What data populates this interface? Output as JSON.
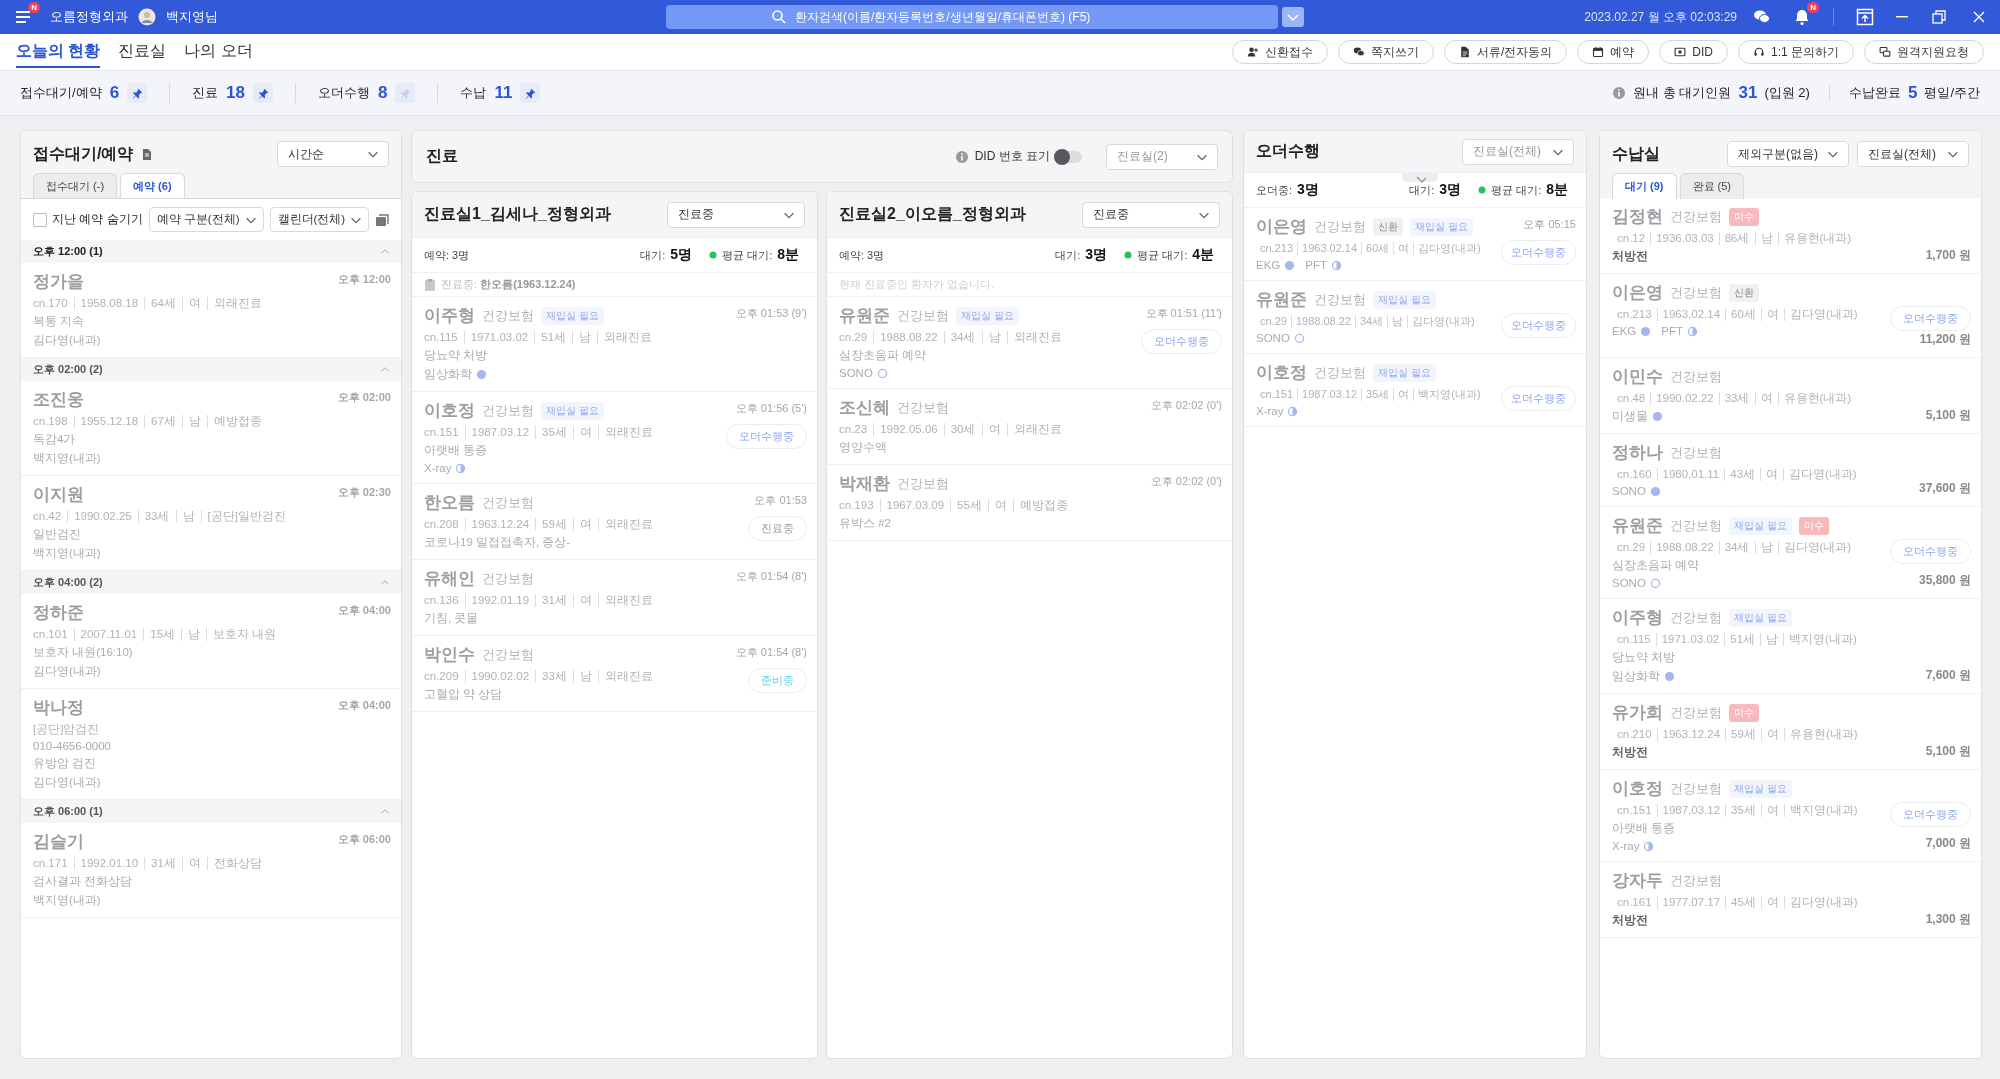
{
  "topbar": {
    "menu_badge": "N",
    "clinic": "오름정형외과",
    "user": "백지영님",
    "search": {
      "placeholder": "환자검색(이름/환자등록번호/생년월일/휴대폰번호) (F5)"
    },
    "datetime": "2023.02.27 월 오후 02:03:29",
    "alert_badge": "N"
  },
  "nav_tabs": [
    {
      "label": "오늘의 현황",
      "selected": true
    },
    {
      "label": "진료실",
      "selected": false
    },
    {
      "label": "나의 오더",
      "selected": false
    }
  ],
  "header_buttons": [
    {
      "label": "신환접수",
      "kind": "person"
    },
    {
      "label": "쪽지쓰기",
      "kind": "chat"
    },
    {
      "label": "서류/전자동의",
      "kind": "document"
    },
    {
      "label": "예약",
      "kind": "calendar"
    },
    {
      "label": "DID",
      "kind": "display"
    },
    {
      "label": "1:1 문의하기",
      "kind": "headset"
    },
    {
      "label": "원격지원요청",
      "kind": "remote"
    }
  ],
  "summary": [
    {
      "label": "접수대기/예약",
      "count": "6",
      "pinned": true
    },
    {
      "label": "진료",
      "count": "18",
      "pinned": true
    },
    {
      "label": "오더수행",
      "count": "8",
      "pinned": false
    },
    {
      "label": "수납",
      "count": "11",
      "pinned": true
    }
  ],
  "waiting_summary": {
    "label": "원내 총 대기인원",
    "count": "31",
    "note": "(입원 2)",
    "paid_label": "수납완료",
    "paid_count": "5",
    "period": "평일/주간"
  },
  "reception": {
    "title": "접수대기/예약",
    "sort": "시간순",
    "tabs": [
      {
        "label": "접수대기 (-)",
        "selected": false
      },
      {
        "label": "예약 (6)",
        "selected": true
      }
    ],
    "hide_past": {
      "label": "지난 예약 숨기기",
      "checked": false
    },
    "filters": [
      "예약 구분(전체)",
      "캘린더(전체)"
    ],
    "groups": [
      {
        "time": "오후 12:00 (1)",
        "expanded": true,
        "patients": [
          {
            "name": "정가을",
            "time": "오후 12:00",
            "meta": [
              "cn.170",
              "1958.08.18",
              "64세",
              "여",
              "외래진료"
            ],
            "notes": [
              "복통 지속",
              "김다영(내과)"
            ]
          }
        ]
      },
      {
        "time": "오후 02:00 (2)",
        "expanded": true,
        "patients": [
          {
            "name": "조진웅",
            "time": "오후 02:00",
            "meta": [
              "cn.198",
              "1955.12.18",
              "67세",
              "남",
              "예방접종"
            ],
            "notes": [
              "독감4가",
              "백지영(내과)"
            ]
          },
          {
            "name": "이지원",
            "time": "오후 02:30",
            "meta": [
              "cn.42",
              "1990.02.25",
              "33세",
              "남",
              "[공단]일반검진"
            ],
            "notes": [
              "일반검진",
              "백지영(내과)"
            ]
          }
        ]
      },
      {
        "time": "오후 04:00 (2)",
        "expanded": true,
        "patients": [
          {
            "name": "정하준",
            "time": "오후 04:00",
            "meta": [
              "cn.101",
              "2007.11.01",
              "15세",
              "남",
              "보호자 내원"
            ],
            "notes": [
              "보호자 내원(16:10)",
              "김다영(내과)"
            ]
          },
          {
            "name": "박나정",
            "time": "오후 04:00",
            "meta": [
              "[공단]암검진"
            ],
            "notes": [
              "010-4656-0000",
              "유방암 검진",
              "김다영(내과)"
            ]
          }
        ]
      },
      {
        "time": "오후 06:00 (1)",
        "expanded": true,
        "patients": [
          {
            "name": "김슬기",
            "time": "오후 06:00",
            "meta": [
              "cn.171",
              "1992.01.10",
              "31세",
              "여",
              "전화상담"
            ],
            "notes": [
              "검사결과 전화상담",
              "백지영(내과)"
            ]
          }
        ]
      }
    ]
  },
  "treatment": {
    "title": "진료",
    "did": {
      "label": "DID 번호 표기",
      "on": false
    },
    "room_filter": "진료실(2)",
    "rooms": [
      {
        "title": "진료실1_김세나_정형외과",
        "status": "진료중",
        "reserved": "예약: 3명",
        "waiting_label": "대기:",
        "waiting": "5명",
        "avg_label": "평균 대기:",
        "avg": "8분",
        "current": {
          "kind": "patient",
          "text": "진료중: **한오름(1963.12.24)**"
        },
        "patients": [
          {
            "name": "이주형",
            "insurance": "건강보험",
            "tags": [
              {
                "text": "재입실 필요",
                "kind": "reentry"
              }
            ],
            "time": "오후 01:53 (9')",
            "meta": [
              "cn.115",
              "1971.03.02",
              "51세",
              "남",
              "외래진료"
            ],
            "notes": [
              "당뇨약 처방"
            ],
            "orders": [
              {
                "name": "임상화학",
                "kind": "done"
              }
            ]
          },
          {
            "name": "이호정",
            "insurance": "건강보험",
            "tags": [
              {
                "text": "재입실 필요",
                "kind": "reentry"
              }
            ],
            "time": "오후 01:56 (5')",
            "meta": [
              "cn.151",
              "1987.03.12",
              "35세",
              "여",
              "외래진료"
            ],
            "notes": [
              "아랫배 통증"
            ],
            "orders": [
              {
                "name": "X-ray",
                "kind": "partial"
              }
            ],
            "badge": {
              "text": "오더수행중",
              "kind": "order"
            }
          },
          {
            "name": "한오름",
            "insurance": "건강보험",
            "time": "오후 01:53",
            "meta": [
              "cn.208",
              "1963.12.24",
              "59세",
              "여",
              "외래진료"
            ],
            "notes": [
              "코로나19 밀접접촉자, 증상-"
            ],
            "badge": {
              "text": "진료중",
              "kind": "treating"
            }
          },
          {
            "name": "유해인",
            "insurance": "건강보험",
            "time": "오후 01:54 (8')",
            "meta": [
              "cn.136",
              "1992.01.19",
              "31세",
              "여",
              "외래진료"
            ],
            "notes": [
              "기침, 콧물"
            ]
          },
          {
            "name": "박인수",
            "insurance": "건강보험",
            "time": "오후 01:54 (8')",
            "meta": [
              "cn.209",
              "1990.02.02",
              "33세",
              "남",
              "외래진료"
            ],
            "notes": [
              "고혈압 약 상담"
            ],
            "badge": {
              "text": "준비중",
              "kind": "ready"
            }
          }
        ]
      },
      {
        "title": "진료실2_이오름_정형외과",
        "status": "진료중",
        "reserved": "예약: 3명",
        "waiting_label": "대기:",
        "waiting": "3명",
        "avg_label": "평균 대기:",
        "avg": "4분",
        "current": {
          "kind": "none",
          "text": "현재 진료중인 환자가 없습니다."
        },
        "patients": [
          {
            "name": "유원준",
            "insurance": "건강보험",
            "tags": [
              {
                "text": "재입실 필요",
                "kind": "reentry"
              }
            ],
            "time": "오후 01:51 (11')",
            "meta": [
              "cn.29",
              "1988.08.22",
              "34세",
              "남",
              "외래진료"
            ],
            "notes": [
              "심장초음파 예약"
            ],
            "orders": [
              {
                "name": "SONO",
                "kind": "pending"
              }
            ],
            "badge": {
              "text": "오더수행중",
              "kind": "order"
            }
          },
          {
            "name": "조신혜",
            "insurance": "건강보험",
            "time": "오후 02:02 (0')",
            "meta": [
              "cn.23",
              "1992.05.06",
              "30세",
              "여",
              "외래진료"
            ],
            "notes": [
              "영양수액"
            ]
          },
          {
            "name": "박재환",
            "insurance": "건강보험",
            "time": "오후 02:02 (0')",
            "meta": [
              "cn.193",
              "1967.03.09",
              "55세",
              "여",
              "예방접종"
            ],
            "notes": [
              "유박스 #2"
            ]
          }
        ]
      }
    ]
  },
  "orders": {
    "title": "오더수행",
    "room_filter": "진료실(전체)",
    "in_progress_label": "오더중:",
    "in_progress": "3명",
    "waiting_label": "대기:",
    "waiting": "3명",
    "avg_label": "평균 대기:",
    "avg": "8분",
    "patients": [
      {
        "name": "이은영",
        "insurance": "건강보험",
        "tags": [
          {
            "text": "신환",
            "kind": "new"
          },
          {
            "text": "재입실 필요",
            "kind": "reentry"
          }
        ],
        "time": "오후 05:15",
        "meta": [
          "cn.213",
          "1963.02.14",
          "60세",
          "여",
          "김다영(내과)"
        ],
        "orders": [
          {
            "name": "EKG",
            "kind": "done"
          },
          {
            "name": "PFT",
            "kind": "partial"
          }
        ],
        "badge": {
          "text": "오더수행중",
          "kind": "order"
        }
      },
      {
        "name": "유원준",
        "insurance": "건강보험",
        "tags": [
          {
            "text": "재입실 필요",
            "kind": "reentry"
          }
        ],
        "meta": [
          "cn.29",
          "1988.08.22",
          "34세",
          "남",
          "김다영(내과)"
        ],
        "orders": [
          {
            "name": "SONO",
            "kind": "pending"
          }
        ],
        "badge": {
          "text": "오더수행중",
          "kind": "order"
        }
      },
      {
        "name": "이호정",
        "insurance": "건강보험",
        "tags": [
          {
            "text": "재입실 필요",
            "kind": "reentry"
          }
        ],
        "meta": [
          "cn.151",
          "1987.03.12",
          "35세",
          "여",
          "백지영(내과)"
        ],
        "orders": [
          {
            "name": "X-ray",
            "kind": "partial"
          }
        ],
        "badge": {
          "text": "오더수행중",
          "kind": "order"
        }
      }
    ]
  },
  "payment": {
    "title": "수납실",
    "filters": [
      "제외구분(없음)",
      "진료실(전체)"
    ],
    "tabs": [
      {
        "label": "대기 (9)",
        "selected": true
      },
      {
        "label": "완료 (5)",
        "selected": false
      }
    ],
    "patients": [
      {
        "name": "김정현",
        "insurance": "건강보험",
        "tags": [
          {
            "text": "미수",
            "kind": "unpaid"
          }
        ],
        "meta": [
          "cn.12",
          "1936.03.03",
          "86세",
          "남",
          "유용현(내과)"
        ],
        "stage": "처방전",
        "amount": "1,700 원"
      },
      {
        "name": "이은영",
        "insurance": "건강보험",
        "tags": [
          {
            "text": "신환",
            "kind": "new"
          }
        ],
        "meta": [
          "cn.213",
          "1963.02.14",
          "60세",
          "여",
          "김다영(내과)"
        ],
        "orders": [
          {
            "name": "EKG",
            "kind": "done"
          },
          {
            "name": "PFT",
            "kind": "partial"
          }
        ],
        "badge": {
          "text": "오더수행중",
          "kind": "order"
        },
        "amount": "11,200 원"
      },
      {
        "name": "이민수",
        "insurance": "건강보험",
        "meta": [
          "cn.48",
          "1990.02.22",
          "33세",
          "여",
          "유용현(내과)"
        ],
        "orders": [
          {
            "name": "미생물",
            "kind": "done"
          }
        ],
        "amount": "5,100 원"
      },
      {
        "name": "정하나",
        "insurance": "건강보험",
        "meta": [
          "cn.160",
          "1980.01.11",
          "43세",
          "여",
          "김다영(내과)"
        ],
        "orders": [
          {
            "name": "SONO",
            "kind": "done"
          }
        ],
        "amount": "37,600 원"
      },
      {
        "name": "유원준",
        "insurance": "건강보험",
        "tags": [
          {
            "text": "재입실 필요",
            "kind": "reentry"
          },
          {
            "text": "미수",
            "kind": "unpaid"
          }
        ],
        "meta": [
          "cn.29",
          "1988.08.22",
          "34세",
          "남",
          "김다영(내과)"
        ],
        "notes": [
          "심장초음파 예약"
        ],
        "orders": [
          {
            "name": "SONO",
            "kind": "pending"
          }
        ],
        "badge": {
          "text": "오더수행중",
          "kind": "order"
        },
        "amount": "35,800 원"
      },
      {
        "name": "이주형",
        "insurance": "건강보험",
        "tags": [
          {
            "text": "재입실 필요",
            "kind": "reentry"
          }
        ],
        "meta": [
          "cn.115",
          "1971.03.02",
          "51세",
          "남",
          "백지영(내과)"
        ],
        "notes": [
          "당뇨약 처방"
        ],
        "orders": [
          {
            "name": "임상화학",
            "kind": "done"
          }
        ],
        "amount": "7,600 원"
      },
      {
        "name": "유가희",
        "insurance": "건강보험",
        "tags": [
          {
            "text": "미수",
            "kind": "unpaid"
          }
        ],
        "meta": [
          "cn.210",
          "1963.12.24",
          "59세",
          "여",
          "유용현(내과)"
        ],
        "stage": "처방전",
        "amount": "5,100 원"
      },
      {
        "name": "이호정",
        "insurance": "건강보험",
        "tags": [
          {
            "text": "재입실 필요",
            "kind": "reentry"
          }
        ],
        "meta": [
          "cn.151",
          "1987.03.12",
          "35세",
          "여",
          "백지영(내과)"
        ],
        "notes": [
          "아랫배 통증"
        ],
        "orders": [
          {
            "name": "X-ray",
            "kind": "partial"
          }
        ],
        "badge": {
          "text": "오더수행중",
          "kind": "order"
        },
        "amount": "7,000 원"
      },
      {
        "name": "강자두",
        "insurance": "건강보험",
        "meta": [
          "cn.161",
          "1977.07.17",
          "45세",
          "여",
          "김다영(내과)"
        ],
        "stage": "처방전",
        "amount": "1,300 원"
      }
    ]
  }
}
